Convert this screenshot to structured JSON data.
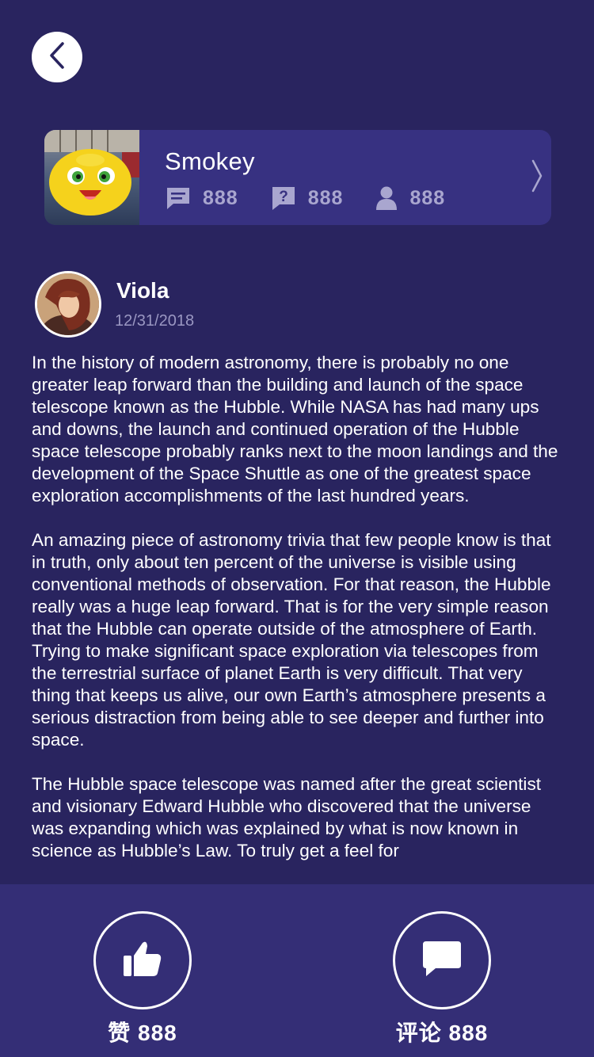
{
  "header": {
    "back_icon": "chevron-left-icon"
  },
  "author_card": {
    "name": "Smokey",
    "stats": [
      {
        "icon": "message-icon",
        "value": "888"
      },
      {
        "icon": "question-icon",
        "value": "888"
      },
      {
        "icon": "user-icon",
        "value": "888"
      }
    ],
    "chevron_icon": "chevron-right-icon"
  },
  "post": {
    "user": "Viola",
    "date": "12/31/2018",
    "paragraphs": [
      "In the history of modern astronomy, there is probably no one greater leap forward than the building and launch of the space telescope known as the Hubble. While NASA has had many ups and downs, the launch and continued operation of the Hubble space telescope probably ranks next to the moon landings and the development of the Space Shuttle as one of the greatest space exploration accomplishments of the last hundred years.",
      "An amazing piece of astronomy trivia that few people know is that in truth, only about ten percent of the universe is visible using conventional methods of observation. For that reason, the Hubble really was a huge leap forward. That is for the very simple reason that the Hubble can operate outside of the atmosphere of Earth. Trying to make significant space exploration via telescopes from the terrestrial surface of planet Earth is very difficult. That very thing that keeps us alive, our own Earth’s atmosphere presents a serious distraction from being able to see deeper and further into space.",
      "The Hubble space telescope was named after the great scientist and visionary Edward Hubble who discovered that the universe was expanding which was explained by what is now known in science as Hubble’s Law. To truly get a feel for"
    ]
  },
  "actions": {
    "like_label": "赞 888",
    "comment_label": "评论 888"
  },
  "colors": {
    "background": "#29245f",
    "card": "#373181",
    "bottom_bar": "#342e76",
    "muted_text": "#a9a6cf"
  }
}
